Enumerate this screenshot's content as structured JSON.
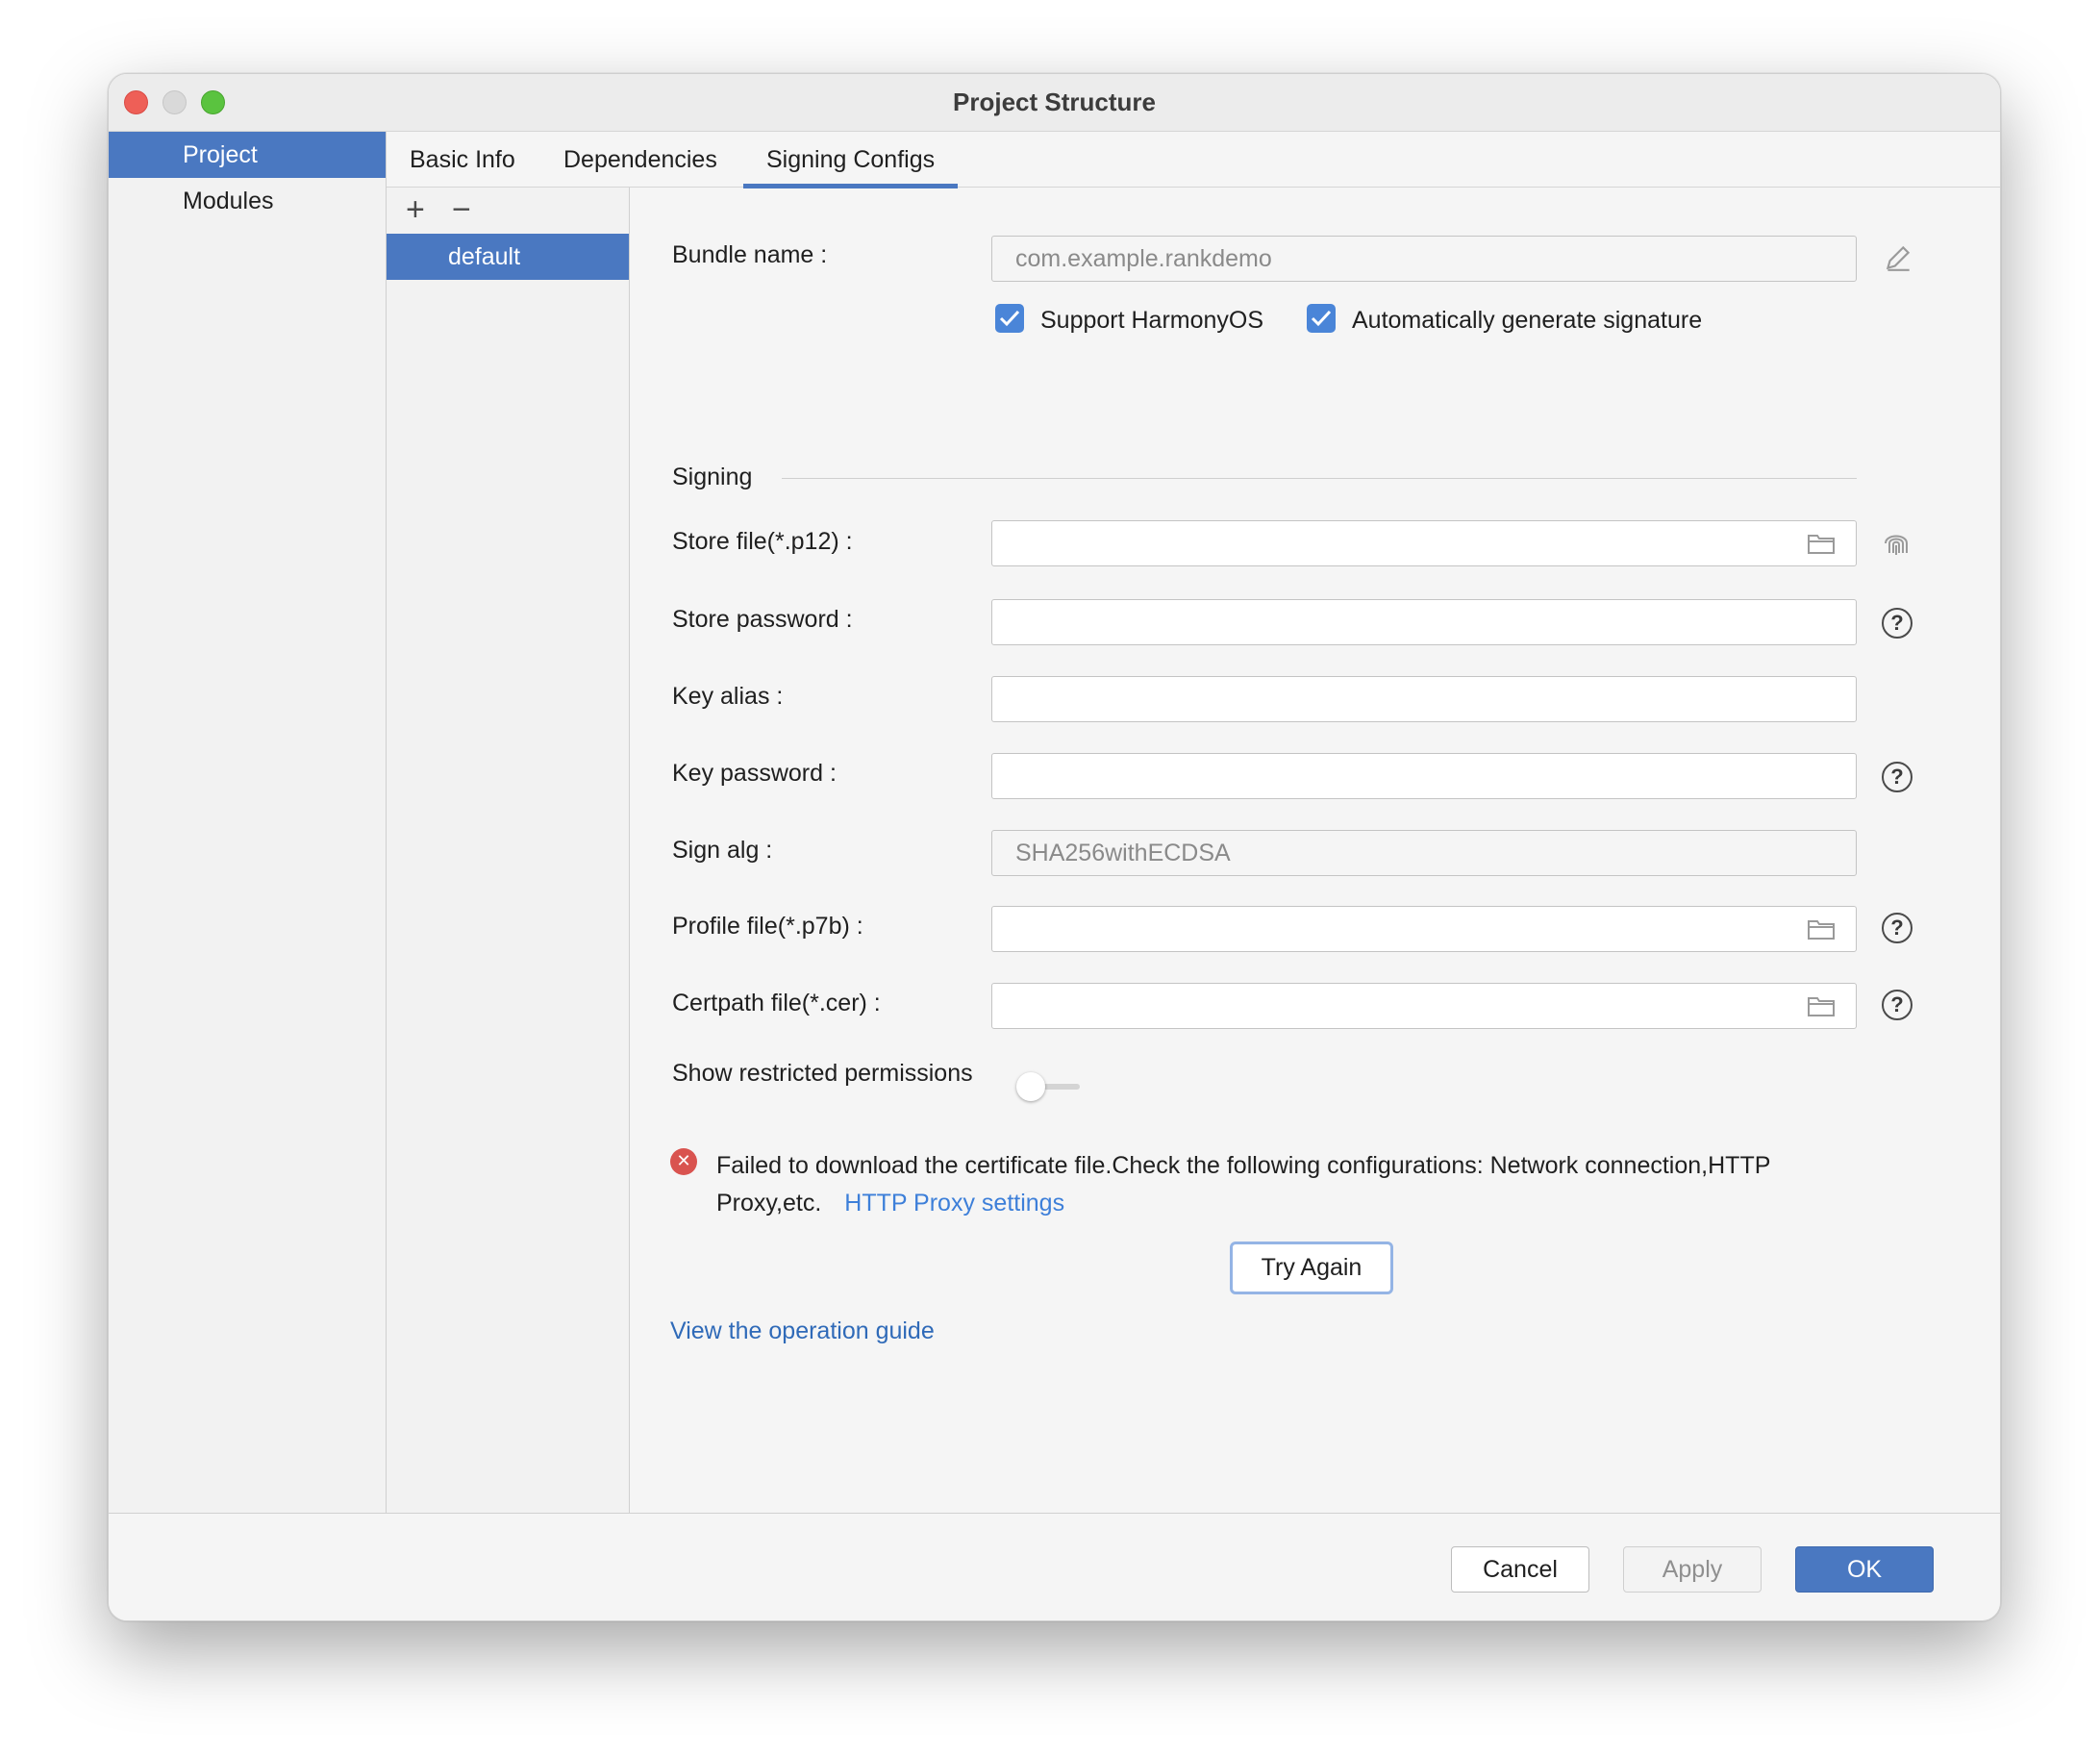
{
  "window": {
    "title": "Project Structure"
  },
  "sidebar": {
    "items": [
      {
        "label": "Project",
        "selected": true
      },
      {
        "label": "Modules",
        "selected": false
      }
    ]
  },
  "tabs": [
    {
      "label": "Basic Info"
    },
    {
      "label": "Dependencies"
    },
    {
      "label": "Signing Configs",
      "active": true
    }
  ],
  "configs": {
    "add_icon": "plus-icon",
    "remove_icon": "minus-icon",
    "items": [
      "default"
    ]
  },
  "form": {
    "bundle_name_label": "Bundle name :",
    "bundle_name_value": "com.example.rankdemo",
    "support_harmonyos_label": "Support HarmonyOS",
    "support_harmonyos_checked": true,
    "auto_signature_label": "Automatically generate signature",
    "auto_signature_checked": true,
    "signing_section": "Signing",
    "store_file_label": "Store file(*.p12) :",
    "store_file_value": "",
    "store_password_label": "Store password :",
    "key_alias_label": "Key alias :",
    "key_password_label": "Key password :",
    "sign_alg_label": "Sign alg :",
    "sign_alg_value": "SHA256withECDSA",
    "profile_file_label": "Profile file(*.p7b) :",
    "certpath_file_label": "Certpath file(*.cer) :",
    "show_restricted_label": "Show restricted permissions",
    "show_restricted_on": false,
    "help_glyph": "?"
  },
  "error": {
    "icon": "error-icon",
    "glyph": "✕",
    "message": "Failed to download the certificate file.Check the following configurations: Network connection,HTTP Proxy,etc.",
    "proxy_link": "HTTP Proxy settings",
    "try_again": "Try Again",
    "guide_link": "View the operation guide"
  },
  "footer": {
    "cancel": "Cancel",
    "apply": "Apply",
    "ok": "OK"
  },
  "colors": {
    "accent": "#4a78c1",
    "link": "#3d7fd9",
    "error": "#d9534f",
    "checkbox": "#4a85d8"
  }
}
